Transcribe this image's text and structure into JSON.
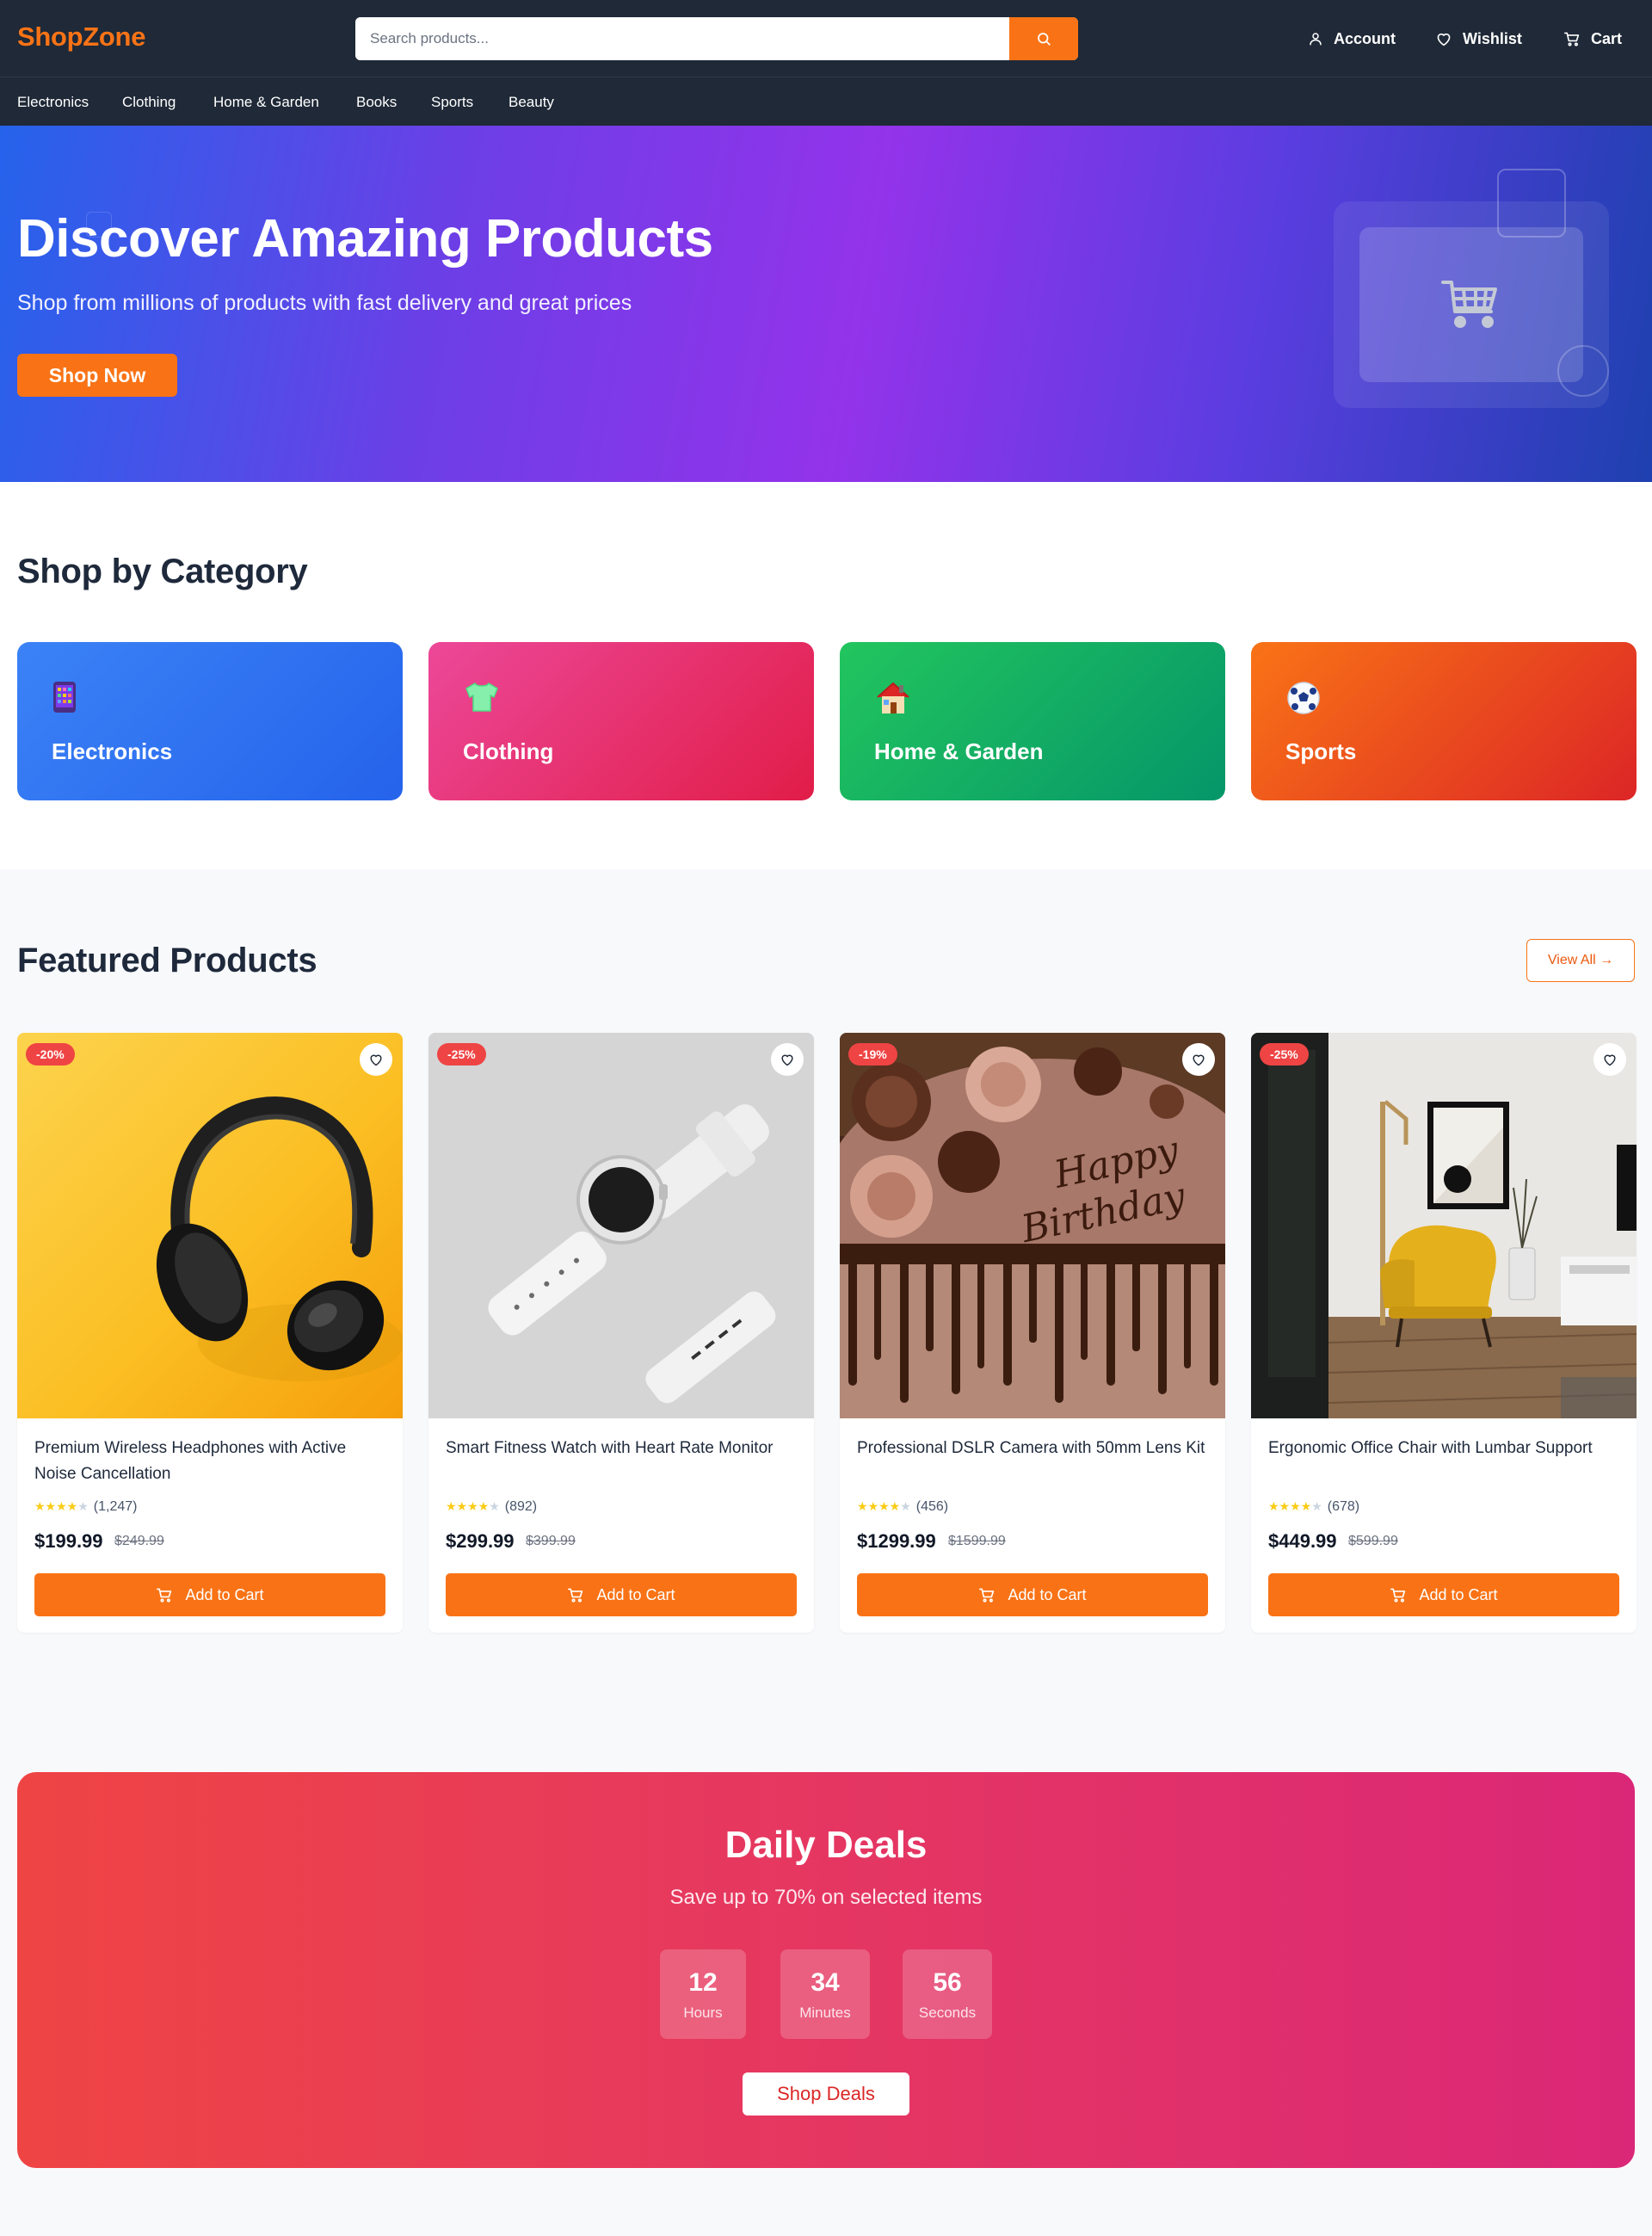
{
  "header": {
    "logo": "ShopZone",
    "search_placeholder": "Search products...",
    "account_label": "Account",
    "wishlist_label": "Wishlist",
    "cart_label": "Cart"
  },
  "nav": {
    "items": [
      "Electronics",
      "Clothing",
      "Home & Garden",
      "Books",
      "Sports",
      "Beauty"
    ]
  },
  "hero": {
    "title": "Discover Amazing Products",
    "subtitle": "Shop from millions of products with fast delivery and great prices",
    "cta_label": "Shop Now"
  },
  "categories": {
    "title": "Shop by Category",
    "items": [
      {
        "label": "Electronics",
        "icon": "📱",
        "icon_name": "phone-icon",
        "color_from": "#3b82f6",
        "color_to": "#2563eb"
      },
      {
        "label": "Clothing",
        "icon": "👕",
        "icon_name": "tshirt-icon",
        "color_from": "#ec4899",
        "color_to": "#e11d48"
      },
      {
        "label": "Home & Garden",
        "icon": "🏠",
        "icon_name": "house-icon",
        "color_from": "#22c55e",
        "color_to": "#059669"
      },
      {
        "label": "Sports",
        "icon": "⚽",
        "icon_name": "soccer-ball-icon",
        "color_from": "#f97316",
        "color_to": "#dc2626"
      }
    ]
  },
  "featured": {
    "title": "Featured Products",
    "view_all_label": "View All →",
    "add_to_cart_label": "Add to Cart",
    "products": [
      {
        "name": "Premium Wireless Headphones with Active Noise Cancellation",
        "discount": "-20%",
        "rating": 4,
        "reviews": "(1,247)",
        "price": "$199.99",
        "old_price": "$249.99",
        "image": "headphones"
      },
      {
        "name": "Smart Fitness Watch with Heart Rate Monitor",
        "discount": "-25%",
        "rating": 4,
        "reviews": "(892)",
        "price": "$299.99",
        "old_price": "$399.99",
        "image": "smartwatch"
      },
      {
        "name": "Professional DSLR Camera with 50mm Lens Kit",
        "discount": "-19%",
        "rating": 4,
        "reviews": "(456)",
        "price": "$1299.99",
        "old_price": "$1599.99",
        "image": "birthday-cake"
      },
      {
        "name": "Ergonomic Office Chair with Lumbar Support",
        "discount": "-25%",
        "rating": 4,
        "reviews": "(678)",
        "price": "$449.99",
        "old_price": "$599.99",
        "image": "armchair-room"
      }
    ]
  },
  "deals": {
    "title": "Daily Deals",
    "subtitle": "Save up to 70% on selected items",
    "timer": [
      {
        "value": "12",
        "label": "Hours"
      },
      {
        "value": "34",
        "label": "Minutes"
      },
      {
        "value": "56",
        "label": "Seconds"
      }
    ],
    "cta_label": "Shop Deals"
  },
  "colors": {
    "accent": "#f97316",
    "header_bg": "#1f2937",
    "badge": "#ef4444"
  }
}
